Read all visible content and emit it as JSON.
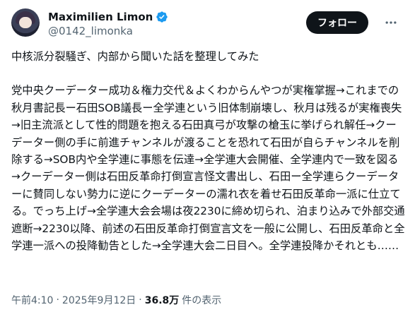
{
  "author": {
    "display_name": "Maximilien Limon",
    "handle": "@0142_limonka"
  },
  "follow_label": "フォロー",
  "more_icon": "more-dots-icon",
  "verified_color": "#1d9bf0",
  "tweet": {
    "line1": "中核派分裂騒ぎ、内部から聞いた話を整理してみた",
    "paragraph2": "党中央クーデーター成功＆権力交代＆よくわからんやつが実権掌握→これまでの秋月書記長ー石田SOB議長ー全学連という旧体制崩壊し、秋月は残るが実権喪失→旧主流派として性的問題を抱える石田真弓が攻撃の槍玉に挙げられ解任→クーデーター側の手に前進チャンネルが渡ることを恐れて石田が自らチャンネルを削除する→SOB内や全学連に事態を伝達→全学連大会開催、全学連内で一致を図る→クーデーター側は石田反革命打倒宣言怪文書出し、石田ー全学連らクーデーターに賛同しない勢力に逆にクーデーターの濡れ衣を着せ石田反革命一派に仕立てる。でっち上げ→全学連大会会場は夜2230に締め切られ、泊まり込みで外部交通遮断→2230以降、前述の石田反革命打倒宣言文を一般に公開し、石田反革命と全学連一派への投降勧告とした→全学連大会二日目へ。全学連投降かそれとも……"
  },
  "meta": {
    "time": "午前4:10",
    "separator": "·",
    "date": "2025年9月12日",
    "separator2": "·",
    "views_count": "36.8万",
    "views_label": "件の表示"
  }
}
